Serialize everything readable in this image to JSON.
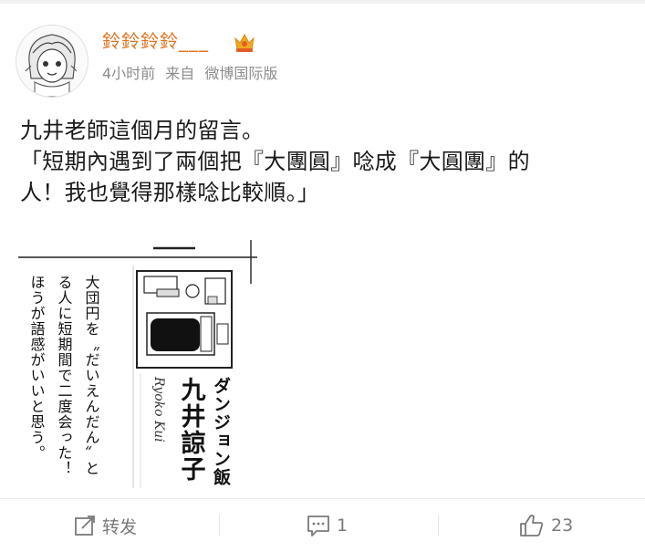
{
  "post": {
    "username": "鈴鈴鈴鈴___",
    "time": "4小时前",
    "source_prefix": "来自",
    "source": "微博国际版",
    "text_lines": [
      "九井老師這個月的留言。",
      "「短期內遇到了兩個把『大團圓』唸成『大圓團』的",
      "人！我也覺得那樣唸比較順。」"
    ]
  },
  "scan": {
    "manga_title": "ダンジョン飯",
    "author_name": "九井諒子",
    "author_romaji": "Ryoko Kui",
    "comment_columns": [
      "大団円を〝だいえんだん〟と",
      "る人に短期間で二度会った！",
      "ほうが語感がいいと思う。"
    ]
  },
  "actions": {
    "repost_label": "转发",
    "comment_count": "1",
    "like_count": "23"
  },
  "colors": {
    "username": "#e2711e",
    "meta": "#8d8d8d",
    "action": "#7a7a7a"
  }
}
